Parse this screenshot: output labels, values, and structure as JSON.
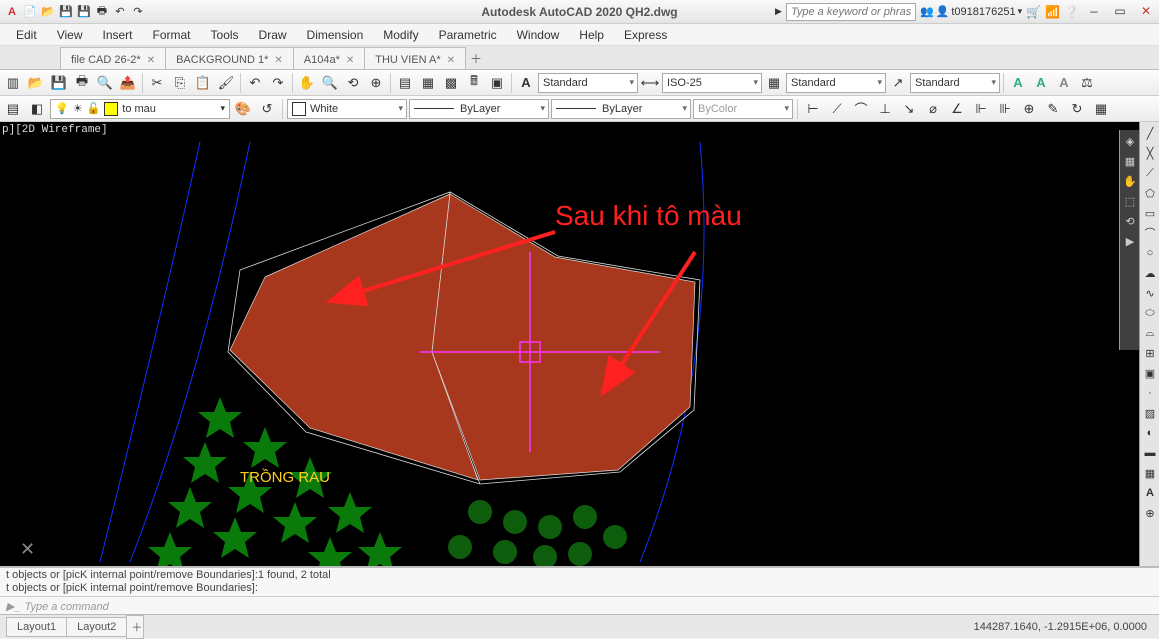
{
  "app": {
    "title": "Autodesk AutoCAD 2020   QH2.dwg",
    "search_placeholder": "Type a keyword or phrase",
    "user": "t0918176251"
  },
  "menu": [
    "Edit",
    "View",
    "Insert",
    "Format",
    "Tools",
    "Draw",
    "Dimension",
    "Modify",
    "Parametric",
    "Window",
    "Help",
    "Express"
  ],
  "tabs": [
    {
      "label": "file CAD 26-2*"
    },
    {
      "label": "BACKGROUND 1*"
    },
    {
      "label": "A104a*"
    },
    {
      "label": "THU VIEN A*"
    }
  ],
  "props": {
    "layer": "to mau",
    "color_label": "White",
    "linetype": "ByLayer",
    "lineweight": "ByLayer",
    "plotstyle": "ByColor"
  },
  "styles": {
    "text": "Standard",
    "dim": "ISO-25",
    "table": "Standard",
    "ml": "Standard"
  },
  "view": {
    "label": "p][2D Wireframe]",
    "annotation": "Sau khi tô màu",
    "drawing_text": "TRỒNG RAU"
  },
  "cmd": {
    "line1": "t objects or [picK internal point/remove Boundaries]:1 found, 2 total",
    "line2": "t objects or [picK internal point/remove Boundaries]:",
    "prompt": "Type a command"
  },
  "layout": {
    "tabs": [
      "Layout1",
      "Layout2"
    ],
    "coords": "144287.1640, -1.2915E+06, 0.0000"
  }
}
